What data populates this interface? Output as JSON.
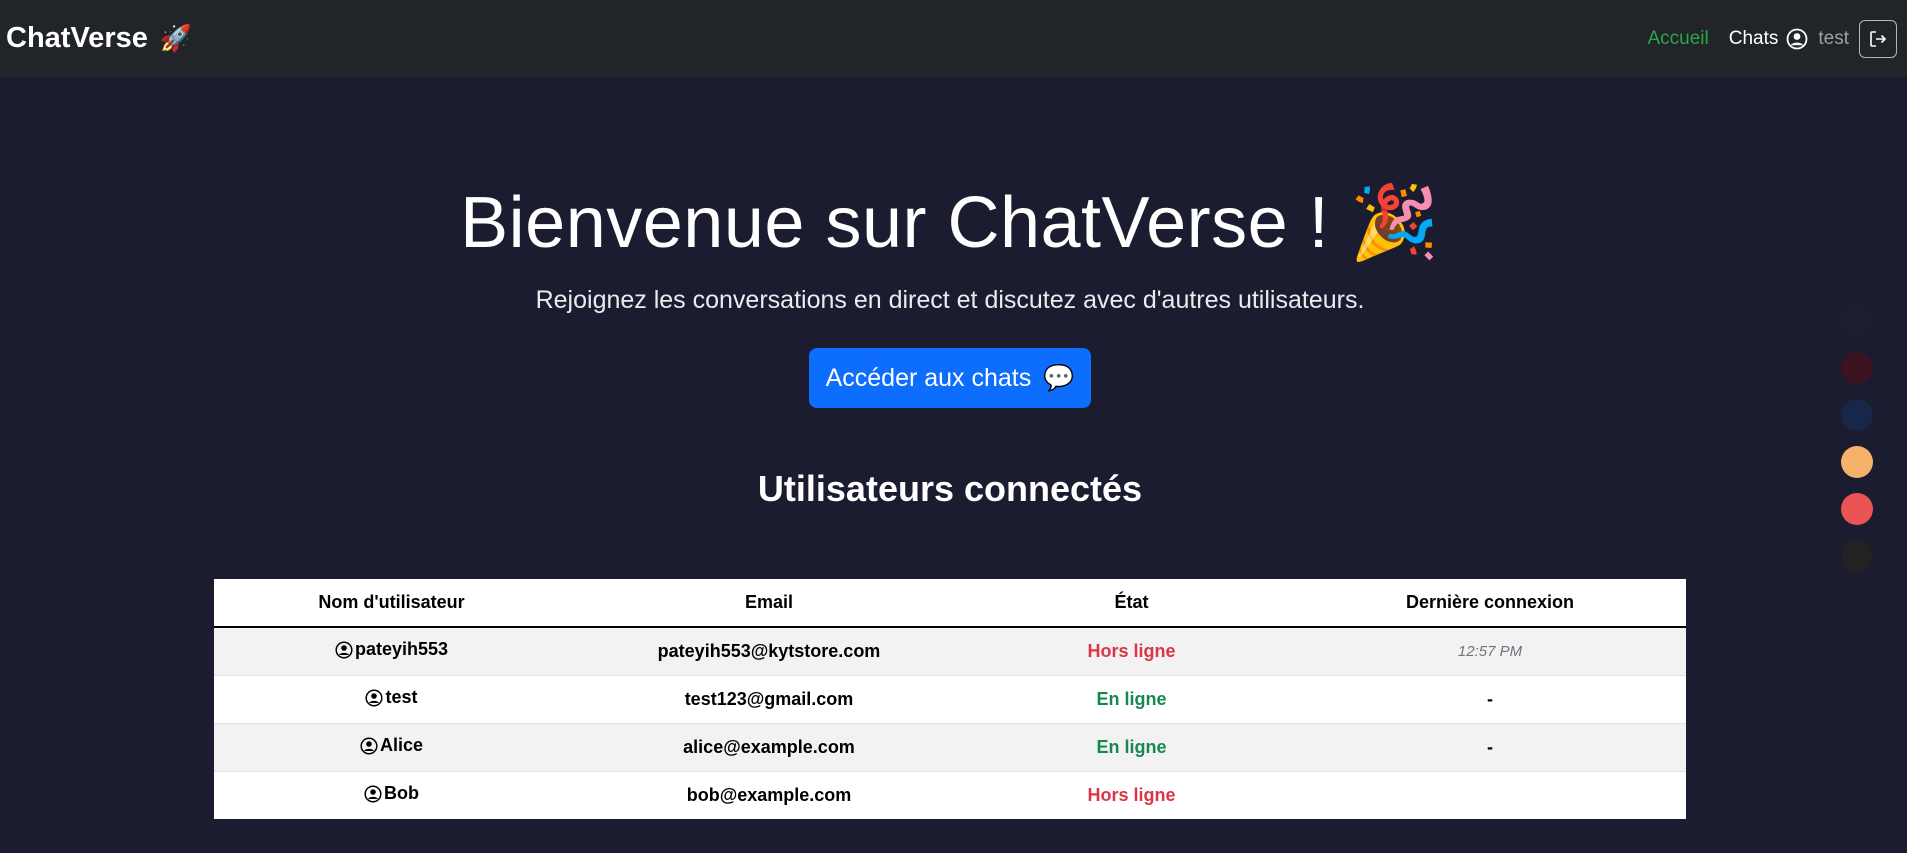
{
  "navbar": {
    "brand": "ChatVerse",
    "brand_emoji": "🚀",
    "links": {
      "home": "Accueil",
      "chats": "Chats"
    },
    "username": "test",
    "colors": {
      "active": "#28a745"
    }
  },
  "hero": {
    "title_prefix": "Bienvenue sur ",
    "title_brand": "ChatVerse",
    "title_suffix": " ! ",
    "title_emoji": "🎉",
    "subtitle": "Rejoignez les conversations en direct et discutez avec d'autres utilisateurs.",
    "cta_label": "Accéder aux chats",
    "cta_icon": "💬"
  },
  "users_section": {
    "title": "Utilisateurs connectés",
    "columns": [
      "Nom d'utilisateur",
      "Email",
      "État",
      "Dernière connexion"
    ],
    "rows": [
      {
        "name": "pateyih553",
        "email": "pateyih553@kytstore.com",
        "status": "Hors ligne",
        "status_type": "offline",
        "last": "12:57 PM"
      },
      {
        "name": "test",
        "email": "test123@gmail.com",
        "status": "En ligne",
        "status_type": "online",
        "last": "-"
      },
      {
        "name": "Alice",
        "email": "alice@example.com",
        "status": "En ligne",
        "status_type": "online",
        "last": "-"
      },
      {
        "name": "Bob",
        "email": "bob@example.com",
        "status": "Hors ligne",
        "status_type": "offline",
        "last": ""
      }
    ]
  },
  "theme_palette": {
    "colors": [
      "#1e1e2e",
      "#3b1421",
      "#18264a",
      "#f6b26b",
      "#ea5455",
      "#222222"
    ]
  }
}
